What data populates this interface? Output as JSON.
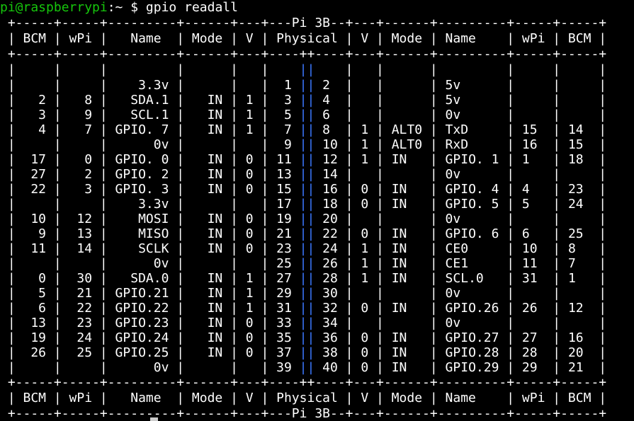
{
  "terminal": {
    "prompt_user": "pi@raspberrypi",
    "prompt_sep": ":~ $",
    "command": "gpio readall"
  },
  "table": {
    "top_border": " +-----+-----+---------+------+---+---Pi 3B--+---+------+---------+-----+-----+",
    "header": " | BCM | wPi |   Name  | Mode | V | Physical | V | Mode | Name    | wPi | BCM |",
    "sep_border": " +-----+-----+---------+------+---+----++----+---+------+---------+-----+-----+",
    "rows": [
      {
        "left": " |     |     |    3.3v |      |   |  1 ",
        "right": " 2  |   |      | 5v      |     |     |"
      },
      {
        "left": " |   2 |   8 |   SDA.1 |   IN | 1 |  3 ",
        "right": " 4  |   |      | 5v      |     |     |"
      },
      {
        "left": " |   3 |   9 |   SCL.1 |   IN | 1 |  5 ",
        "right": " 6  |   |      | 0v      |     |     |"
      },
      {
        "left": " |   4 |   7 | GPIO. 7 |   IN | 1 |  7 ",
        "right": " 8  | 1 | ALT0 | TxD     | 15  | 14  |"
      },
      {
        "left": " |     |     |      0v |      |   |  9 ",
        "right": " 10 | 1 | ALT0 | RxD     | 16  | 15  |"
      },
      {
        "left": " |  17 |   0 | GPIO. 0 |   IN | 0 | 11 ",
        "right": " 12 | 1 | IN   | GPIO. 1 | 1   | 18  |"
      },
      {
        "left": " |  27 |   2 | GPIO. 2 |   IN | 0 | 13 ",
        "right": " 14 |   |      | 0v      |     |     |"
      },
      {
        "left": " |  22 |   3 | GPIO. 3 |   IN | 0 | 15 ",
        "right": " 16 | 0 | IN   | GPIO. 4 | 4   | 23  |"
      },
      {
        "left": " |     |     |    3.3v |      |   | 17 ",
        "right": " 18 | 0 | IN   | GPIO. 5 | 5   | 24  |"
      },
      {
        "left": " |  10 |  12 |    MOSI |   IN | 0 | 19 ",
        "right": " 20 |   |      | 0v      |     |     |"
      },
      {
        "left": " |   9 |  13 |    MISO |   IN | 0 | 21 ",
        "right": " 22 | 0 | IN   | GPIO. 6 | 6   | 25  |"
      },
      {
        "left": " |  11 |  14 |    SCLK |   IN | 0 | 23 ",
        "right": " 24 | 1 | IN   | CE0     | 10  | 8   |"
      },
      {
        "left": " |     |     |      0v |      |   | 25 ",
        "right": " 26 | 1 | IN   | CE1     | 11  | 7   |"
      },
      {
        "left": " |   0 |  30 |   SDA.0 |   IN | 1 | 27 ",
        "right": " 28 | 1 | IN   | SCL.0   | 31  | 1   |"
      },
      {
        "left": " |   5 |  21 | GPIO.21 |   IN | 1 | 29 ",
        "right": " 30 |   |      | 0v      |     |     |"
      },
      {
        "left": " |   6 |  22 | GPIO.22 |   IN | 1 | 31 ",
        "right": " 32 | 0 | IN   | GPIO.26 | 26  | 12  |"
      },
      {
        "left": " |  13 |  23 | GPIO.23 |   IN | 0 | 33 ",
        "right": " 34 |   |      | 0v      |     |     |"
      },
      {
        "left": " |  19 |  24 | GPIO.24 |   IN | 0 | 35 ",
        "right": " 36 | 0 | IN   | GPIO.27 | 27  | 16  |"
      },
      {
        "left": " |  26 |  25 | GPIO.25 |   IN | 0 | 37 ",
        "right": " 38 | 0 | IN   | GPIO.28 | 28  | 20  |"
      },
      {
        "left": " |     |     |      0v |      |   | 39 ",
        "right": " 40 | 0 | IN   | GPIO.29 | 29  | 21  |"
      }
    ],
    "pipe_pair": "||",
    "blank_row_left": " |     |     |         |      |   |    ",
    "blank_row_right": "    |   |      |         |     |     |",
    "bottom_sep": " +-----+-----+---------+------+---+----++----+---+------+---------+-----+-----+",
    "footer": " | BCM | wPi |   Name  | Mode | V | Physical | V | Mode | Name    | wPi | BCM |",
    "bottom_border": " +-----+-----+---------+------+---+---Pi 3B--+---+------+---------+-----+-----+"
  }
}
